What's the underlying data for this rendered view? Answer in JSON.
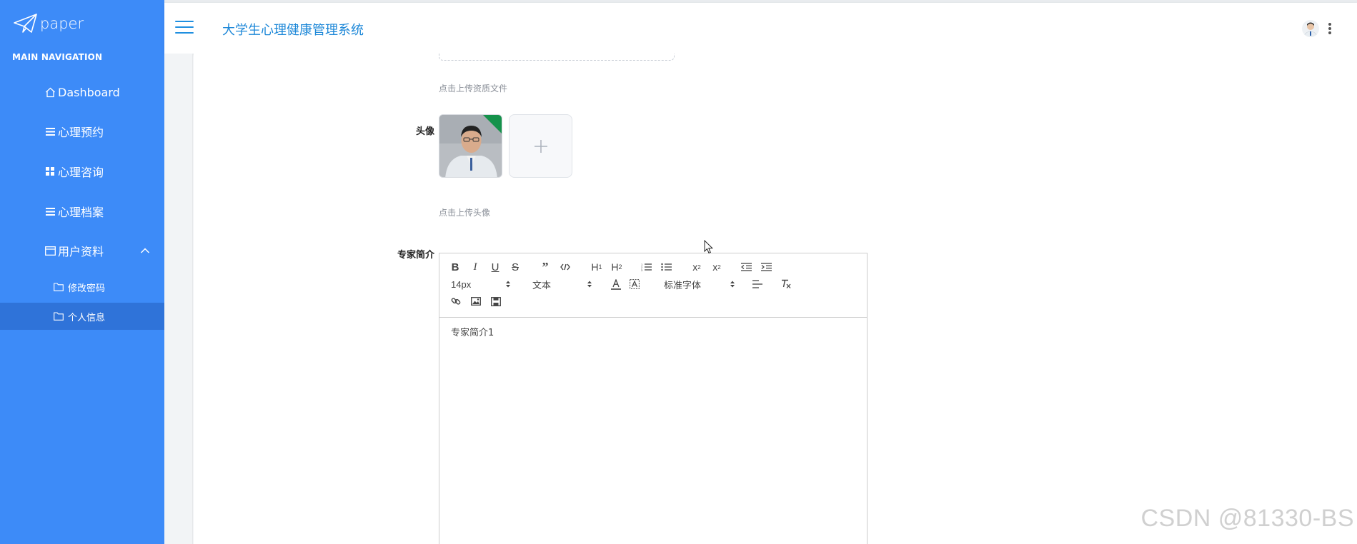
{
  "sidebar": {
    "brand": "paper",
    "section_title": "MAIN NAVIGATION",
    "items": [
      {
        "label": "Dashboard"
      },
      {
        "label": "心理预约"
      },
      {
        "label": "心理咨询"
      },
      {
        "label": "心理档案"
      },
      {
        "label": "用户资料"
      }
    ],
    "sub_items": [
      {
        "label": "修改密码"
      },
      {
        "label": "个人信息"
      }
    ]
  },
  "header": {
    "title": "大学生心理健康管理系统"
  },
  "form": {
    "cert_hint": "点击上传资质文件",
    "avatar_label": "头像",
    "avatar_hint": "点击上传头像",
    "intro_label": "专家简介",
    "intro_content": "专家简介1"
  },
  "editor": {
    "font_size": "14px",
    "block_type": "文本",
    "font_family": "标准字体"
  },
  "watermark": "CSDN @81330-BS",
  "colors": {
    "sidebar_bg": "#3d8bf8",
    "sidebar_active": "#2f73d9",
    "title_blue": "#1e88d8"
  }
}
